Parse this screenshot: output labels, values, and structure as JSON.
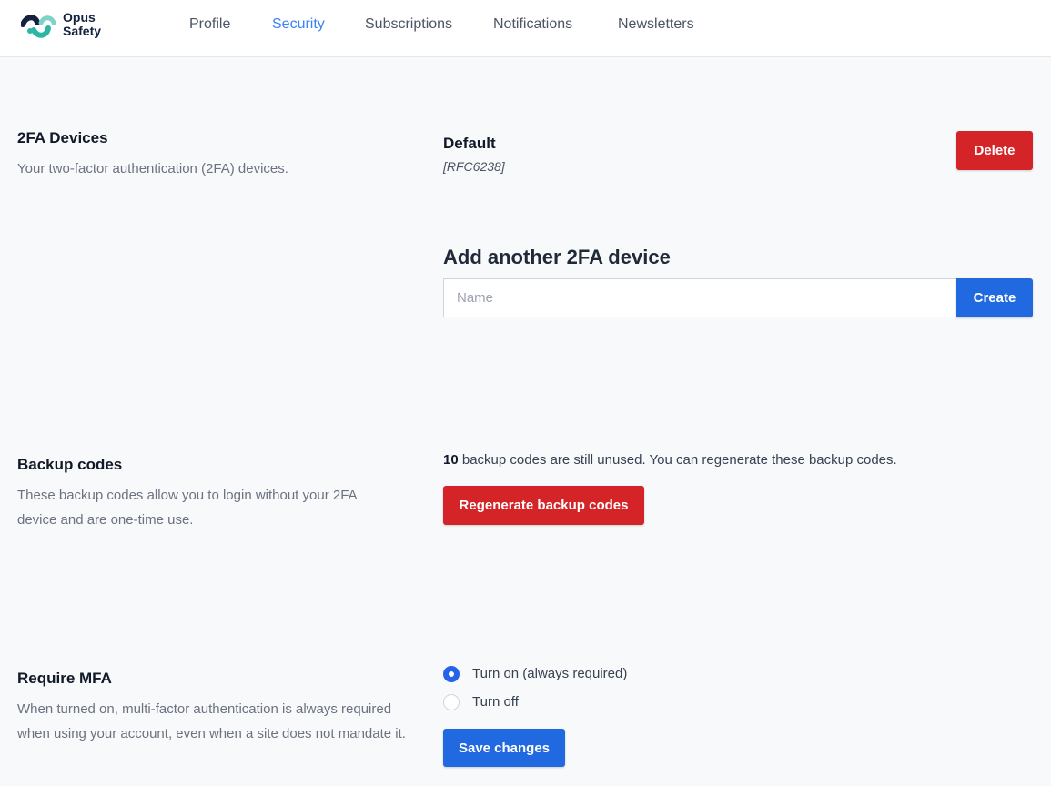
{
  "brand": {
    "line1": "Opus",
    "line2": "Safety"
  },
  "nav": {
    "profile": "Profile",
    "security": "Security",
    "subscriptions": "Subscriptions",
    "notifications": "Notifications",
    "newsletters": "Newsletters",
    "active": "Security"
  },
  "twofa": {
    "title": "2FA Devices",
    "description": "Your two-factor authentication (2FA) devices.",
    "device": {
      "name": "Default",
      "type": "[RFC6238]",
      "delete_label": "Delete"
    },
    "add_title": "Add another 2FA device",
    "name_placeholder": "Name",
    "name_value": "",
    "create_label": "Create"
  },
  "backup": {
    "title": "Backup codes",
    "description": "These backup codes allow you to login without your 2FA device and are one-time use.",
    "count": "10",
    "status_text": " backup codes are still unused. You can regenerate these backup codes.",
    "regenerate_label": "Regenerate backup codes"
  },
  "mfa": {
    "title": "Require MFA",
    "description": "When turned on, multi-factor authentication is always required when using your account, even when a site does not mandate it.",
    "options": [
      {
        "label": "Turn on (always required)",
        "checked": true
      },
      {
        "label": "Turn off",
        "checked": false
      }
    ],
    "save_label": "Save changes"
  },
  "colors": {
    "accent": "#2169e0",
    "danger": "#d42427",
    "nav_active": "#3b82f6",
    "brand_dark": "#13233f",
    "brand_teal": "#2bb7a3"
  },
  "icons": {
    "logo": "opus-safety-logo-icon"
  }
}
